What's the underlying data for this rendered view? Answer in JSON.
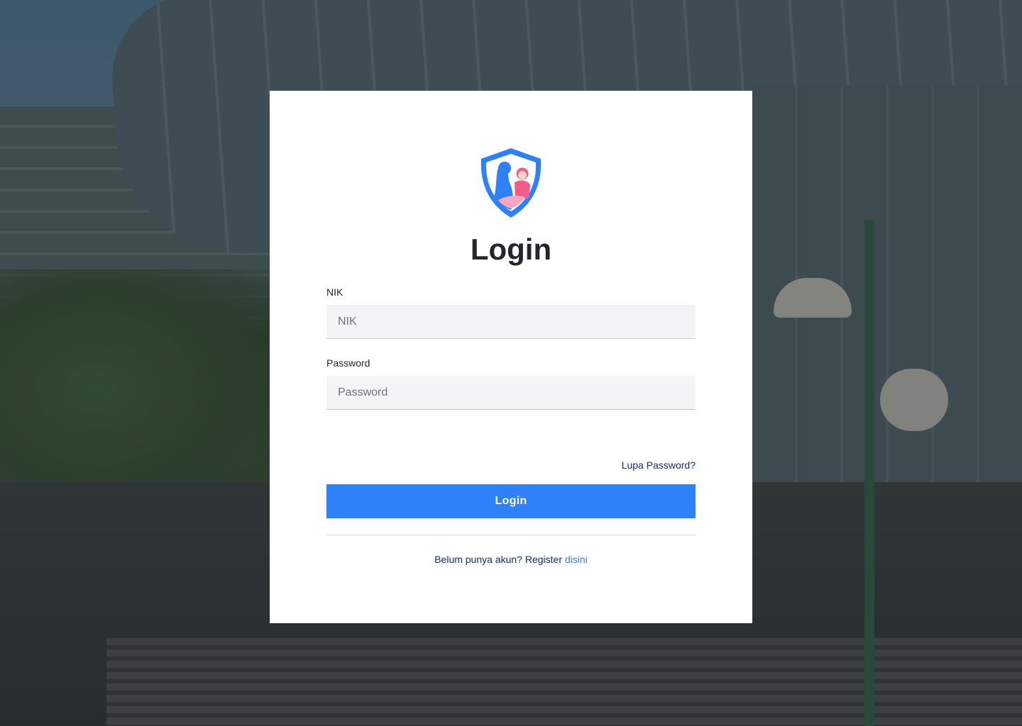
{
  "login": {
    "title": "Login",
    "nik_label": "NIK",
    "nik_placeholder": "NIK",
    "nik_value": "",
    "password_label": "Password",
    "password_placeholder": "Password",
    "password_value": "",
    "forgot_label": "Lupa Password?",
    "submit_label": "Login",
    "register_prefix": "Belum punya akun? Register ",
    "register_link": "disini"
  },
  "icons": {
    "logo": "mother-child-shield-icon"
  },
  "colors": {
    "primary": "#2f80fb",
    "link_dark": "#0f2d66",
    "input_bg": "#f3f4f6",
    "logo_blue": "#2f80fb",
    "logo_pink": "#f25c8a"
  }
}
